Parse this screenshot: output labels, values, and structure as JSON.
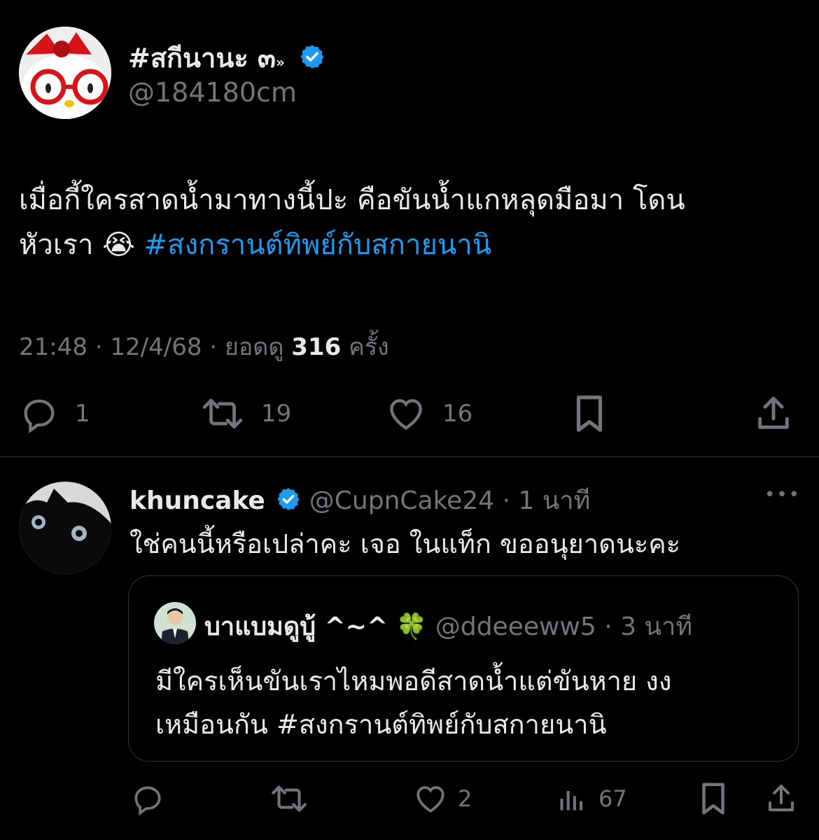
{
  "main_tweet": {
    "display_name": "#สกีนานะ ๓",
    "name_suffix": "»",
    "handle": "@184180cm",
    "text_part1": "เมื่อกี้ใครสาดน้ำมาทางนี้ปะ คือขันน้ำแกหลุดมือมา โดน",
    "text_part2": "หัวเรา",
    "emoji": "😭",
    "hashtag": "#สงกรานต์ทิพย์กับสกายนานิ",
    "time": "21:48",
    "date": "12/4/68",
    "views_label": "ยอดดู",
    "views_count": "316",
    "views_unit": "ครั้ง",
    "replies": "1",
    "retweets": "19",
    "likes": "16"
  },
  "reply": {
    "display_name": "khuncake",
    "handle": "@CupnCake24",
    "time_ago": "1 นาที",
    "more": "•••",
    "text": "ใช่คนนี้หรือเปล่าคะ เจอ ในแท็ก ขออนุยาดนะคะ",
    "likes": "2",
    "views": "67"
  },
  "quoted": {
    "display_name": "บาแบมดูบู้ ^~^",
    "emoji": "🍀",
    "handle": "@ddeeeww5",
    "time_ago": "3 นาที",
    "text_line1": "มีใครเห็นขันเราไหมพอดีสาดน้ำแต่ขันหาย งง",
    "text_line2_plain": "เหมือนกัน",
    "hashtag": "#สงกรานต์ทิพย์กับสกายนานิ"
  },
  "colors": {
    "background": "#000000",
    "text": "#e7e9ea",
    "muted": "#71767b",
    "accent": "#1d9bf0",
    "border": "#2f3336"
  },
  "icons": [
    "verified-badge-icon",
    "reply-icon",
    "retweet-icon",
    "like-icon",
    "bookmark-icon",
    "share-icon",
    "views-icon",
    "more-icon"
  ]
}
